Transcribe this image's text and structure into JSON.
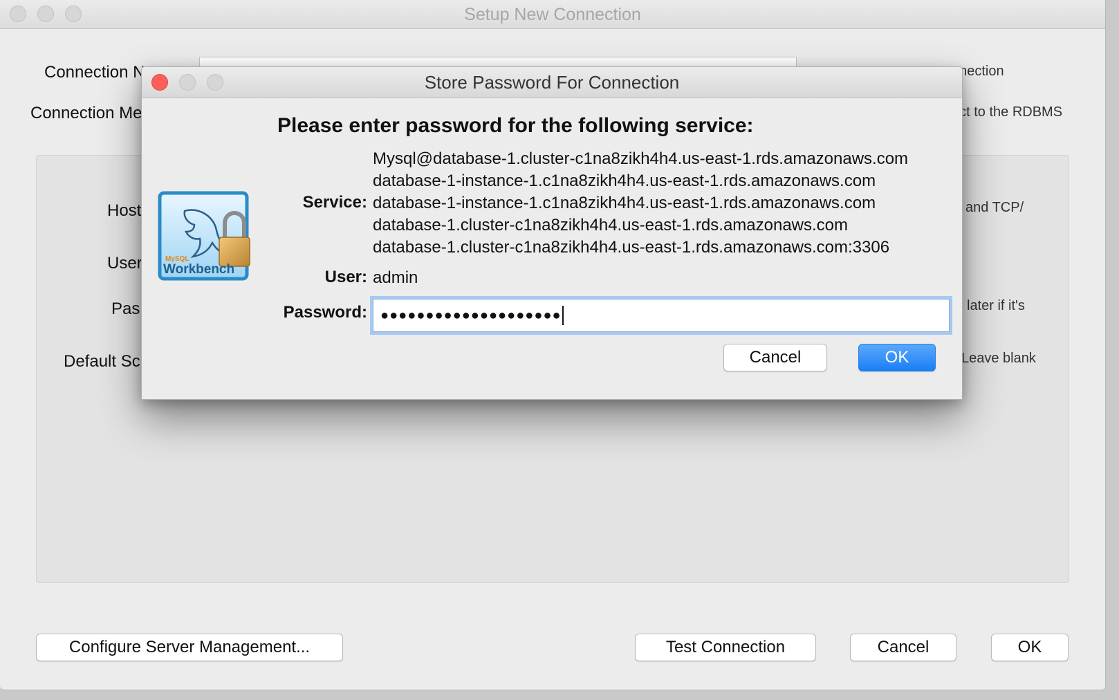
{
  "main_window": {
    "title": "Setup New Connection",
    "labels": {
      "connection_name": "Connection N",
      "connection_method": "Connection Me",
      "hostname": "Host",
      "username": "User",
      "password": "Pas",
      "default_schema": "Default Sc"
    },
    "hints": {
      "connection_name": "nnection",
      "connection_method": "ect to the RDBMS",
      "hostname": "and TCP/",
      "password": "later if it's",
      "default_schema": "Leave blank"
    },
    "buttons": {
      "configure": "Configure Server Management...",
      "test": "Test Connection",
      "cancel": "Cancel",
      "ok": "OK"
    }
  },
  "dialog": {
    "title": "Store Password For Connection",
    "heading": "Please enter password for the following service:",
    "service_label": "Service:",
    "services": [
      "Mysql@database-1.cluster-c1na8zikh4h4.us-east-1.rds.amazonaws.com",
      "database-1-instance-1.c1na8zikh4h4.us-east-1.rds.amazonaws.com",
      "database-1-instance-1.c1na8zikh4h4.us-east-1.rds.amazonaws.com",
      "database-1.cluster-c1na8zikh4h4.us-east-1.rds.amazonaws.com",
      "database-1.cluster-c1na8zikh4h4.us-east-1.rds.amazonaws.com:3306"
    ],
    "user_label": "User:",
    "user_value": "admin",
    "password_label": "Password:",
    "password_mask": "●●●●●●●●●●●●●●●●●●●●",
    "cancel": "Cancel",
    "ok": "OK",
    "logo_text": "Workbench",
    "logo_small": "MySQL"
  }
}
